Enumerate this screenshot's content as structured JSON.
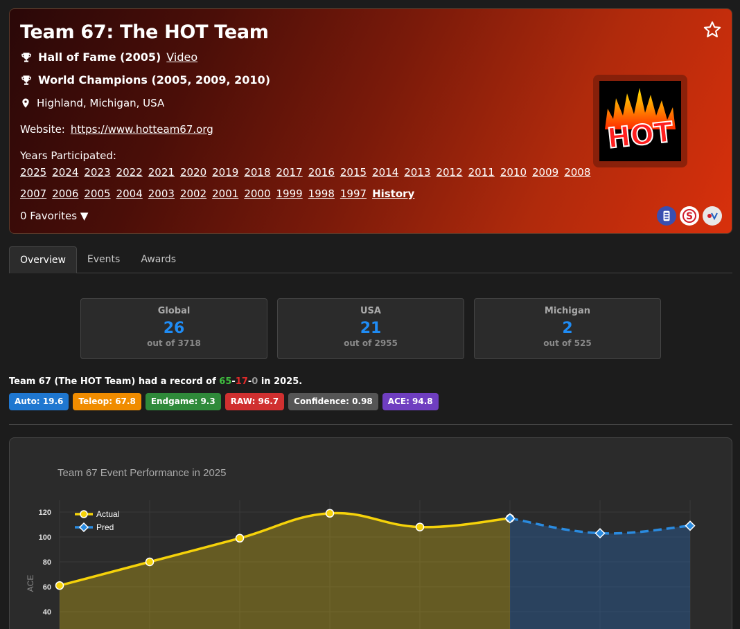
{
  "team": {
    "title": "Team 67: The HOT Team",
    "hall_of_fame": "Hall of Fame (2005)",
    "video_link": "Video",
    "world_champions": "World Champions (2005, 2009, 2010)",
    "location": "Highland, Michigan, USA",
    "website_label": "Website:",
    "website_url": "https://www.hotteam67.org",
    "years_label": "Years Participated:",
    "years_row1": [
      "2025",
      "2024",
      "2023",
      "2022",
      "2021",
      "2020",
      "2019",
      "2018",
      "2017",
      "2016",
      "2015",
      "2014",
      "2013",
      "2012",
      "2011",
      "2010",
      "2009",
      "2008"
    ],
    "years_row2": [
      "2007",
      "2006",
      "2005",
      "2004",
      "2003",
      "2002",
      "2001",
      "2000",
      "1999",
      "1998",
      "1997"
    ],
    "history_link": "History",
    "favorites": "0 Favorites ▼",
    "logo_text": "HOT"
  },
  "tabs": [
    "Overview",
    "Events",
    "Awards"
  ],
  "ranks": [
    {
      "label": "Global",
      "value": "26",
      "sub": "out of 3718"
    },
    {
      "label": "USA",
      "value": "21",
      "sub": "out of 2955"
    },
    {
      "label": "Michigan",
      "value": "2",
      "sub": "out of 525"
    }
  ],
  "record": {
    "prefix": "Team 67 (The HOT Team) had a record of ",
    "wins": "65",
    "sep1": "-",
    "losses": "17",
    "sep2": "-",
    "ties": "0",
    "suffix": " in 2025."
  },
  "badges": [
    {
      "text": "Auto: 19.6",
      "color": "#1f77d0"
    },
    {
      "text": "Teleop: 67.8",
      "color": "#f08c00"
    },
    {
      "text": "Endgame: 9.3",
      "color": "#2f8a3a"
    },
    {
      "text": "RAW: 96.7",
      "color": "#d03030"
    },
    {
      "text": "Confidence: 0.98",
      "color": "#555555"
    },
    {
      "text": "ACE: 94.8",
      "color": "#6f3ec0"
    }
  ],
  "chart_data": {
    "type": "line",
    "title": "Team 67 Event Performance in 2025",
    "ylabel": "ACE",
    "yticks": [
      40,
      60,
      80,
      100,
      120
    ],
    "series": [
      {
        "name": "Actual",
        "color": "#f5d20a",
        "values": [
          {
            "i": 0,
            "y": 61
          },
          {
            "i": 1,
            "y": 80
          },
          {
            "i": 2,
            "y": 99
          },
          {
            "i": 3,
            "y": 119
          },
          {
            "i": 4,
            "y": 108
          },
          {
            "i": 5,
            "y": 115
          }
        ]
      },
      {
        "name": "Pred",
        "color": "#2a8be0",
        "values": [
          {
            "i": 5,
            "y": 115
          },
          {
            "i": 6,
            "y": 103
          },
          {
            "i": 7,
            "y": 109
          }
        ]
      }
    ],
    "legend": "top-left"
  }
}
